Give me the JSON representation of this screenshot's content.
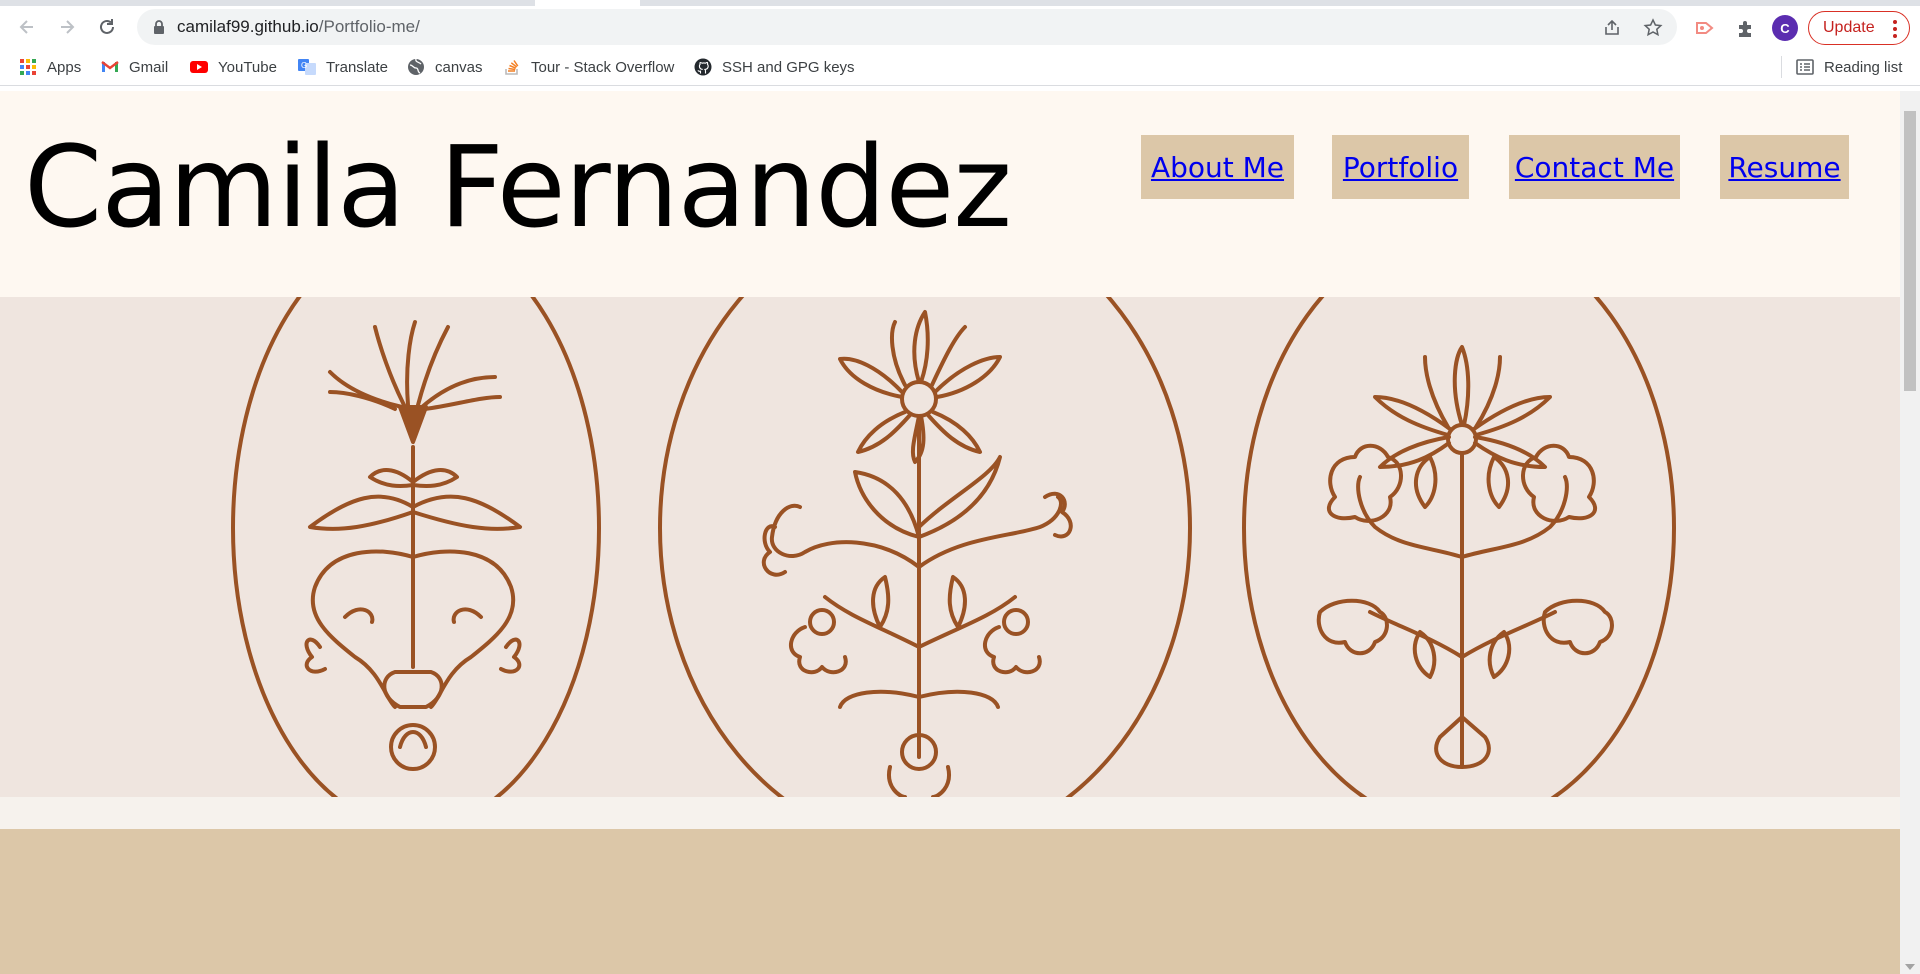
{
  "browser": {
    "url_host": "camilaf99.github.io",
    "url_path": "/Portfolio-me/",
    "profile_initial": "C",
    "update_label": "Update",
    "reading_list_label": "Reading list",
    "bookmarks": [
      {
        "label": "Apps",
        "icon": "apps-grid-icon"
      },
      {
        "label": "Gmail",
        "icon": "gmail-icon"
      },
      {
        "label": "YouTube",
        "icon": "youtube-icon"
      },
      {
        "label": "Translate",
        "icon": "translate-icon"
      },
      {
        "label": "canvas",
        "icon": "globe-icon"
      },
      {
        "label": "Tour - Stack Overflow",
        "icon": "stackoverflow-icon"
      },
      {
        "label": "SSH and GPG keys",
        "icon": "github-icon"
      }
    ]
  },
  "site": {
    "title": "Camila Fernandez",
    "nav": [
      {
        "label": "About Me"
      },
      {
        "label": "Portfolio"
      },
      {
        "label": "Contact Me"
      },
      {
        "label": "Resume"
      }
    ]
  },
  "colors": {
    "header_bg": "#fef8f1",
    "nav_bg": "#dcc7a8",
    "link": "#0000ee",
    "hero_bg": "#efe5df",
    "illustration": "#9a5224",
    "section_bg": "#dcc7a8"
  }
}
